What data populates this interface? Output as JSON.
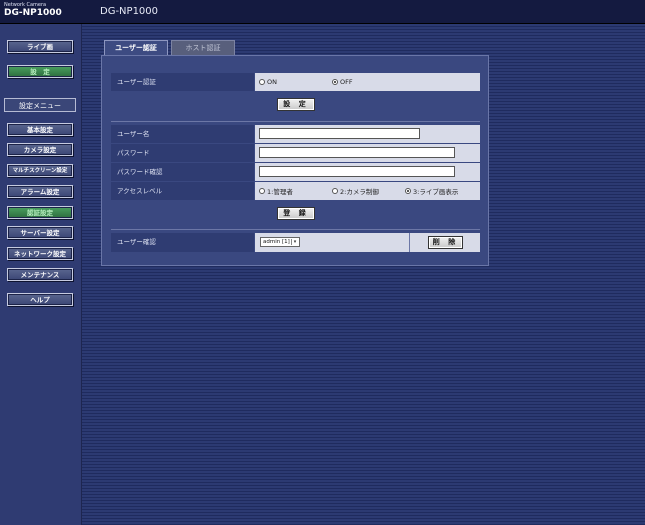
{
  "header": {
    "brand_small": "Network Camera",
    "brand_model": "DG-NP1000",
    "page_title": "DG-NP1000"
  },
  "sidebar": {
    "live_button": "ライブ画",
    "settings_button": "設　定",
    "menu_heading": "設定メニュー",
    "items": [
      {
        "label": "基本設定"
      },
      {
        "label": "カメラ設定"
      },
      {
        "label": "マルチスクリーン設定"
      },
      {
        "label": "アラーム設定"
      },
      {
        "label": "認証設定"
      },
      {
        "label": "サーバー設定"
      },
      {
        "label": "ネットワーク設定"
      },
      {
        "label": "メンテナンス"
      },
      {
        "label": "ヘルプ"
      }
    ]
  },
  "tabs": [
    {
      "label": "ユーザー認証"
    },
    {
      "label": "ホスト認証"
    }
  ],
  "form": {
    "user_auth_label": "ユーザー認証",
    "user_auth_on": "ON",
    "user_auth_off": "OFF",
    "user_auth_selected": "OFF",
    "set_button": "設 定",
    "username_label": "ユーザー名",
    "username_value": "",
    "password_label": "パスワード",
    "password_value": "",
    "password_confirm_label": "パスワード確認",
    "password_confirm_value": "",
    "access_level_label": "アクセスレベル",
    "access_levels": [
      "1:管理者",
      "2:カメラ制御",
      "3:ライブ画表示"
    ],
    "access_level_selected": "3:ライブ画表示",
    "register_button": "登 録",
    "user_check_label": "ユーザー確認",
    "user_select_value": "admin [1]",
    "delete_button": "削 除"
  }
}
